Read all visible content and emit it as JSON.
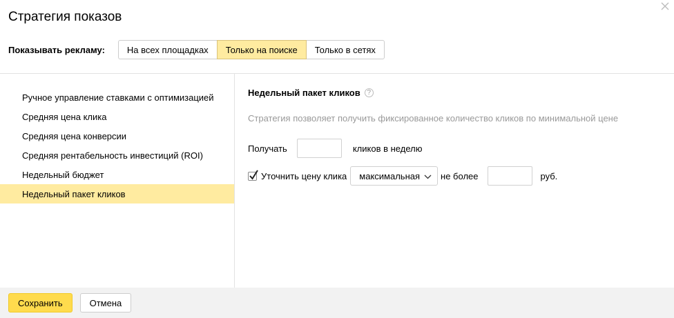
{
  "dialog": {
    "title": "Стратегия показов"
  },
  "show_ads": {
    "label": "Показывать рекламу:",
    "options": [
      {
        "label": "На всех площадках",
        "active": false
      },
      {
        "label": "Только на поиске",
        "active": true
      },
      {
        "label": "Только в сетях",
        "active": false
      }
    ]
  },
  "strategies": [
    {
      "label": "Ручное управление ставками с оптимизацией",
      "active": false
    },
    {
      "label": "Средняя цена клика",
      "active": false
    },
    {
      "label": "Средняя цена конверсии",
      "active": false
    },
    {
      "label": "Средняя рентабельность инвестиций (ROI)",
      "active": false
    },
    {
      "label": "Недельный бюджет",
      "active": false
    },
    {
      "label": "Недельный пакет кликов",
      "active": true
    }
  ],
  "panel": {
    "title": "Недельный пакет кликов",
    "help_icon": "?",
    "description": "Стратегия позволяет получить фиксированное количество кликов по минимальной цене",
    "clicks_row": {
      "before": "Получать",
      "value": "",
      "after": "кликов в неделю"
    },
    "price_row": {
      "checked": true,
      "label": "Уточнить цену клика",
      "select_value": "максимальная",
      "no_more": "не более",
      "value": "",
      "currency": "руб."
    }
  },
  "footer": {
    "save": "Сохранить",
    "cancel": "Отмена"
  },
  "colors": {
    "accent_yellow": "#ffeba0",
    "save_button": "#ffdb4d",
    "footer_bg": "#f2f2f2",
    "muted_text": "#999999"
  }
}
